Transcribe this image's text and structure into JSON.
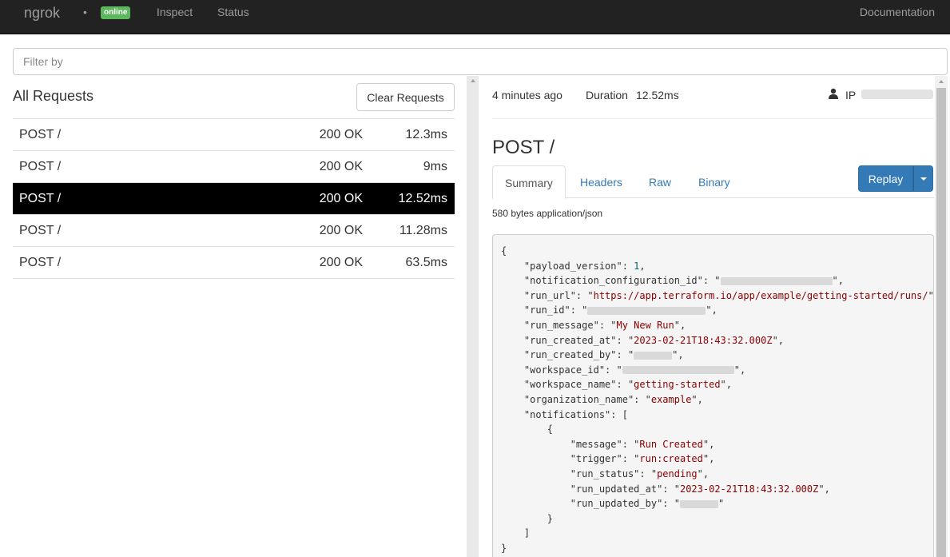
{
  "nav": {
    "brand": "ngrok",
    "status_badge": "online",
    "links": [
      "Inspect",
      "Status"
    ],
    "docs": "Documentation"
  },
  "filter": {
    "placeholder": "Filter by"
  },
  "requests": {
    "title": "All Requests",
    "clear_label": "Clear Requests",
    "rows": [
      {
        "method": "POST /",
        "status": "200 OK",
        "duration": "12.3ms"
      },
      {
        "method": "POST /",
        "status": "200 OK",
        "duration": "9ms"
      },
      {
        "method": "POST /",
        "status": "200 OK",
        "duration": "12.52ms",
        "selected": true
      },
      {
        "method": "POST /",
        "status": "200 OK",
        "duration": "11.28ms"
      },
      {
        "method": "POST /",
        "status": "200 OK",
        "duration": "63.5ms"
      }
    ]
  },
  "detail": {
    "time_ago": "4 minutes ago",
    "duration_label": "Duration",
    "duration_value": "12.52ms",
    "ip_label": "IP",
    "title": "POST /",
    "tabs": [
      "Summary",
      "Headers",
      "Raw",
      "Binary"
    ],
    "active_tab": "Summary",
    "replay_label": "Replay",
    "content_info": "580 bytes application/json",
    "json_body": {
      "payload_version": "1",
      "run_url": "https://app.terraform.io/app/example/getting-started/runs/",
      "run_message": "My New Run",
      "run_created_at": "2023-02-21T18:43:32.000Z",
      "workspace_name": "getting-started",
      "organization_name": "example",
      "notification_message": "Run Created",
      "notification_trigger": "run:created",
      "notification_run_status": "pending",
      "notification_run_updated_at": "2023-02-21T18:43:32.000Z"
    }
  },
  "colors": {
    "navbar": "#222222",
    "online_badge": "#5cb85c",
    "selected_row": "#000000",
    "primary": "#337ab7",
    "string": "#880000",
    "number": "#006666"
  },
  "icons": {
    "user": "user-icon",
    "caret": "caret-down-icon"
  }
}
